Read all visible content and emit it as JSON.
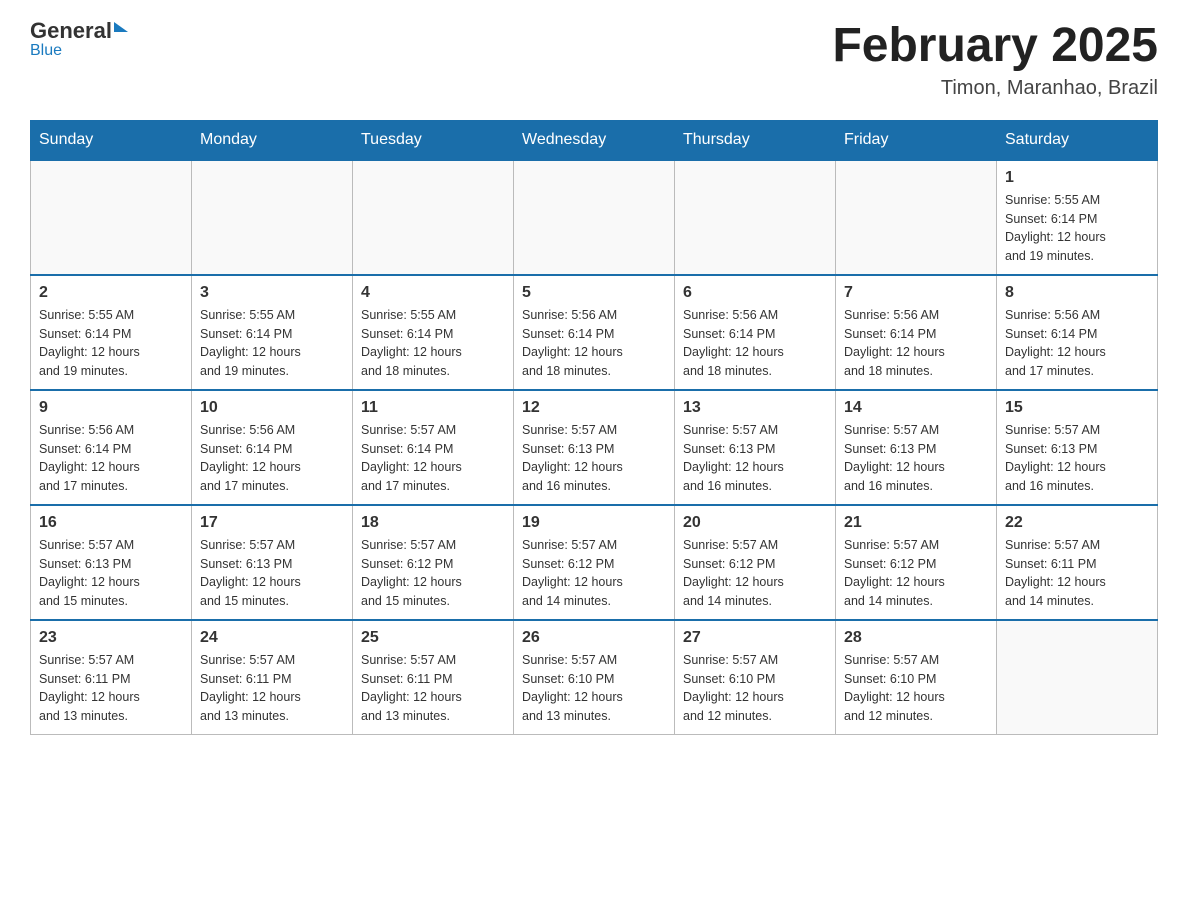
{
  "header": {
    "logo_general": "General",
    "logo_blue": "Blue",
    "month_title": "February 2025",
    "location": "Timon, Maranhao, Brazil"
  },
  "days_of_week": [
    "Sunday",
    "Monday",
    "Tuesday",
    "Wednesday",
    "Thursday",
    "Friday",
    "Saturday"
  ],
  "weeks": [
    {
      "cells": [
        {
          "day": "",
          "info": ""
        },
        {
          "day": "",
          "info": ""
        },
        {
          "day": "",
          "info": ""
        },
        {
          "day": "",
          "info": ""
        },
        {
          "day": "",
          "info": ""
        },
        {
          "day": "",
          "info": ""
        },
        {
          "day": "1",
          "info": "Sunrise: 5:55 AM\nSunset: 6:14 PM\nDaylight: 12 hours\nand 19 minutes."
        }
      ]
    },
    {
      "cells": [
        {
          "day": "2",
          "info": "Sunrise: 5:55 AM\nSunset: 6:14 PM\nDaylight: 12 hours\nand 19 minutes."
        },
        {
          "day": "3",
          "info": "Sunrise: 5:55 AM\nSunset: 6:14 PM\nDaylight: 12 hours\nand 19 minutes."
        },
        {
          "day": "4",
          "info": "Sunrise: 5:55 AM\nSunset: 6:14 PM\nDaylight: 12 hours\nand 18 minutes."
        },
        {
          "day": "5",
          "info": "Sunrise: 5:56 AM\nSunset: 6:14 PM\nDaylight: 12 hours\nand 18 minutes."
        },
        {
          "day": "6",
          "info": "Sunrise: 5:56 AM\nSunset: 6:14 PM\nDaylight: 12 hours\nand 18 minutes."
        },
        {
          "day": "7",
          "info": "Sunrise: 5:56 AM\nSunset: 6:14 PM\nDaylight: 12 hours\nand 18 minutes."
        },
        {
          "day": "8",
          "info": "Sunrise: 5:56 AM\nSunset: 6:14 PM\nDaylight: 12 hours\nand 17 minutes."
        }
      ]
    },
    {
      "cells": [
        {
          "day": "9",
          "info": "Sunrise: 5:56 AM\nSunset: 6:14 PM\nDaylight: 12 hours\nand 17 minutes."
        },
        {
          "day": "10",
          "info": "Sunrise: 5:56 AM\nSunset: 6:14 PM\nDaylight: 12 hours\nand 17 minutes."
        },
        {
          "day": "11",
          "info": "Sunrise: 5:57 AM\nSunset: 6:14 PM\nDaylight: 12 hours\nand 17 minutes."
        },
        {
          "day": "12",
          "info": "Sunrise: 5:57 AM\nSunset: 6:13 PM\nDaylight: 12 hours\nand 16 minutes."
        },
        {
          "day": "13",
          "info": "Sunrise: 5:57 AM\nSunset: 6:13 PM\nDaylight: 12 hours\nand 16 minutes."
        },
        {
          "day": "14",
          "info": "Sunrise: 5:57 AM\nSunset: 6:13 PM\nDaylight: 12 hours\nand 16 minutes."
        },
        {
          "day": "15",
          "info": "Sunrise: 5:57 AM\nSunset: 6:13 PM\nDaylight: 12 hours\nand 16 minutes."
        }
      ]
    },
    {
      "cells": [
        {
          "day": "16",
          "info": "Sunrise: 5:57 AM\nSunset: 6:13 PM\nDaylight: 12 hours\nand 15 minutes."
        },
        {
          "day": "17",
          "info": "Sunrise: 5:57 AM\nSunset: 6:13 PM\nDaylight: 12 hours\nand 15 minutes."
        },
        {
          "day": "18",
          "info": "Sunrise: 5:57 AM\nSunset: 6:12 PM\nDaylight: 12 hours\nand 15 minutes."
        },
        {
          "day": "19",
          "info": "Sunrise: 5:57 AM\nSunset: 6:12 PM\nDaylight: 12 hours\nand 14 minutes."
        },
        {
          "day": "20",
          "info": "Sunrise: 5:57 AM\nSunset: 6:12 PM\nDaylight: 12 hours\nand 14 minutes."
        },
        {
          "day": "21",
          "info": "Sunrise: 5:57 AM\nSunset: 6:12 PM\nDaylight: 12 hours\nand 14 minutes."
        },
        {
          "day": "22",
          "info": "Sunrise: 5:57 AM\nSunset: 6:11 PM\nDaylight: 12 hours\nand 14 minutes."
        }
      ]
    },
    {
      "cells": [
        {
          "day": "23",
          "info": "Sunrise: 5:57 AM\nSunset: 6:11 PM\nDaylight: 12 hours\nand 13 minutes."
        },
        {
          "day": "24",
          "info": "Sunrise: 5:57 AM\nSunset: 6:11 PM\nDaylight: 12 hours\nand 13 minutes."
        },
        {
          "day": "25",
          "info": "Sunrise: 5:57 AM\nSunset: 6:11 PM\nDaylight: 12 hours\nand 13 minutes."
        },
        {
          "day": "26",
          "info": "Sunrise: 5:57 AM\nSunset: 6:10 PM\nDaylight: 12 hours\nand 13 minutes."
        },
        {
          "day": "27",
          "info": "Sunrise: 5:57 AM\nSunset: 6:10 PM\nDaylight: 12 hours\nand 12 minutes."
        },
        {
          "day": "28",
          "info": "Sunrise: 5:57 AM\nSunset: 6:10 PM\nDaylight: 12 hours\nand 12 minutes."
        },
        {
          "day": "",
          "info": ""
        }
      ]
    }
  ]
}
